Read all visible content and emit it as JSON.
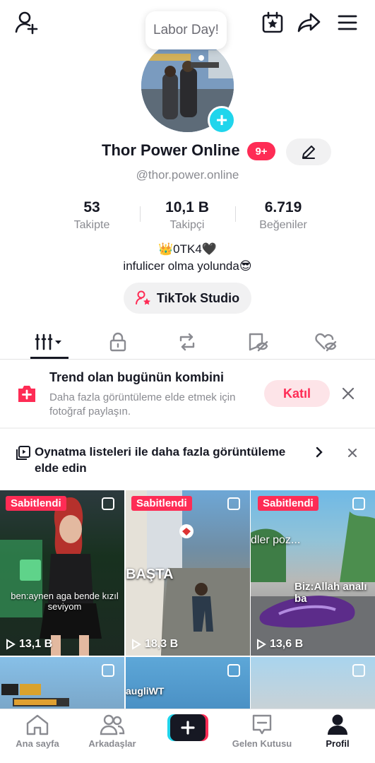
{
  "tooltip": "Labor Day!",
  "profile": {
    "display_name": "Thor Power Online",
    "notification_badge": "9+",
    "username": "@thor.power.online",
    "stats": {
      "following": {
        "value": "53",
        "label": "Takipte"
      },
      "followers": {
        "value": "10,1 B",
        "label": "Takipçi"
      },
      "likes": {
        "value": "6.719",
        "label": "Beğeniler"
      }
    },
    "bio_line1": "👑0TK4🖤",
    "bio_line2": "infulicer olma yolunda😎",
    "studio_button": "TikTok Studio"
  },
  "tabs": [
    "videos-grid-icon",
    "lock-icon",
    "repost-icon",
    "saved-icon",
    "liked-icon"
  ],
  "trend_banner": {
    "title": "Trend olan bugünün kombini",
    "description": "Daha fazla görüntüleme elde etmek için fotoğraf paylaşın.",
    "join_label": "Katıl"
  },
  "playlist_banner": {
    "text": "Oynatma listeleri ile daha fazla görüntüleme elde edin"
  },
  "videos": [
    {
      "pinned_label": "Sabitlendi",
      "views": "13,1 B",
      "caption": "ben:aynen aga bende kızıl seviyom"
    },
    {
      "pinned_label": "Sabitlendi",
      "views": "18,3 B",
      "caption": "BAŞTA"
    },
    {
      "pinned_label": "Sabitlendi",
      "views": "13,6 B",
      "caption": "Biz:Allah analı ba",
      "caption_top": "dler poz..."
    },
    {
      "views": ""
    },
    {
      "caption": "augliWT"
    },
    {
      "views": ""
    }
  ],
  "bottom_nav": {
    "home": "Ana sayfa",
    "friends": "Arkadaşlar",
    "inbox": "Gelen Kutusu",
    "profile": "Profil"
  },
  "colors": {
    "accent": "#fe2c55",
    "cyan": "#20d5ec",
    "text": "#161823",
    "muted": "#8a8b91"
  }
}
